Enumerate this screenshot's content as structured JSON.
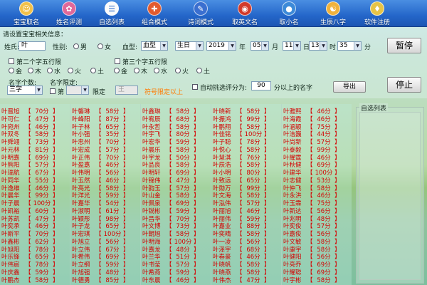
{
  "toolbar": {
    "items": [
      {
        "label": "宝宝取名",
        "icon": "baby-icon",
        "color": "#f2c14a",
        "glyph": "☺"
      },
      {
        "label": "姓名评测",
        "icon": "flower-icon",
        "color": "#e0689a",
        "glyph": "✿"
      },
      {
        "label": "自选列表",
        "icon": "list-icon",
        "color": "#fbfbfb",
        "glyph": "☰"
      },
      {
        "label": "组合模式",
        "icon": "puzzle-icon",
        "color": "#e25b2f",
        "glyph": "✚"
      },
      {
        "label": "诗词模式",
        "icon": "book-icon",
        "color": "#3a6fd0",
        "glyph": "✎"
      },
      {
        "label": "取英文名",
        "icon": "globe-icon",
        "color": "#d23a2a",
        "glyph": "◉"
      },
      {
        "label": "取小名",
        "icon": "sphere-icon",
        "color": "#3d8ad8",
        "glyph": "●"
      },
      {
        "label": "生辰八字",
        "icon": "bagua-icon",
        "color": "#f0b23c",
        "glyph": "☯"
      },
      {
        "label": "软件注册",
        "icon": "lock-icon",
        "color": "#e7c447",
        "glyph": "♦"
      }
    ]
  },
  "settings": {
    "group_title": "请设置宝宝相关信息：",
    "surname_label": "姓氏:",
    "surname_value": "叶",
    "gender_label": "性别:",
    "gender_male": "男",
    "gender_female": "女",
    "blood_label": "血型:",
    "blood_value": "血型",
    "birthday_type": "生日",
    "year_value": "2019",
    "year_unit": "年",
    "month_value": "05",
    "month_unit": "月",
    "day_value": "11",
    "day_unit": "日",
    "hour_value": "13",
    "hour_unit": "时",
    "minute_value": "35",
    "minute_unit": "分",
    "pause_button": "暂停",
    "second_char_limit": "第二个字五行限",
    "third_char_limit": "第三个字五行限",
    "elements": [
      "金",
      "木",
      "水",
      "火",
      "土"
    ],
    "name_count_label": "名字个数:",
    "name_count_value": "三字",
    "name_limit_label": "名字限定:",
    "name_limit_pos": "第",
    "limit_char_label": "限定",
    "limit_char_value": "王",
    "hint_text": "符号限定以上",
    "auto_pick_label": "自动挑选评分为:",
    "auto_pick_score": "90",
    "score_suffix": "分以上的名字",
    "export_button": "导出",
    "stop_button": "停止",
    "self_list_title": "自选列表",
    "colors": {
      "accent_red": "#d50000",
      "hint_orange": "#ff7a00",
      "toolbar_blue": "#2466c9"
    }
  },
  "results": {
    "columns": [
      [
        {
          "name": "叶晋旭",
          "score": "70分"
        },
        {
          "name": "叶可仁",
          "score": "47分"
        },
        {
          "name": "叶宛州",
          "score": "46分"
        },
        {
          "name": "叶双冬",
          "score": "58分"
        },
        {
          "name": "叶舜翊",
          "score": "73分"
        },
        {
          "name": "叶元林",
          "score": "81分"
        },
        {
          "name": "叶明嘉",
          "score": "69分"
        },
        {
          "name": "叶熊阳",
          "score": "57分"
        },
        {
          "name": "叶瑞航",
          "score": "67分"
        },
        {
          "name": "叶同华",
          "score": "55分"
        },
        {
          "name": "叶逸维",
          "score": "46分"
        },
        {
          "name": "叶晨华",
          "score": "99分"
        },
        {
          "name": "叶子晨",
          "score": "100分"
        },
        {
          "name": "叶凯裕",
          "score": "60分"
        },
        {
          "name": "叶苏凯",
          "score": "47分"
        },
        {
          "name": "叶奕承",
          "score": "46分"
        },
        {
          "name": "叶斯平",
          "score": "70分"
        },
        {
          "name": "叶鑫彬",
          "score": "62分"
        },
        {
          "name": "叶旭阳",
          "score": "78分"
        },
        {
          "name": "叶乐锋",
          "score": "65分"
        },
        {
          "name": "叶伟宸",
          "score": "78分"
        },
        {
          "name": "叶庆鑫",
          "score": "59分"
        },
        {
          "name": "叶鹏杰",
          "score": "58分"
        }
      ],
      [
        {
          "name": "叶馨琳",
          "score": "58分"
        },
        {
          "name": "叶峰阳",
          "score": "87分"
        },
        {
          "name": "叶子林",
          "score": "65分"
        },
        {
          "name": "叶小强",
          "score": "35分"
        },
        {
          "name": "叶忠州",
          "score": "70分"
        },
        {
          "name": "叶宏成",
          "score": "57分"
        },
        {
          "name": "叶正伟",
          "score": "70分"
        },
        {
          "name": "叶盈嘉",
          "score": "46分"
        },
        {
          "name": "叶伟明",
          "score": "56分"
        },
        {
          "name": "叶玉然",
          "score": "46分"
        },
        {
          "name": "叶亮光",
          "score": "58分"
        },
        {
          "name": "叶洋光",
          "score": "59分"
        },
        {
          "name": "叶嘉华",
          "score": "54分"
        },
        {
          "name": "叶淑明",
          "score": "61分"
        },
        {
          "name": "叶颖彤",
          "score": "98分"
        },
        {
          "name": "叶子龙",
          "score": "65分"
        },
        {
          "name": "叶宏琪",
          "score": "100分"
        },
        {
          "name": "叶旭立",
          "score": "56分"
        },
        {
          "name": "叶立伟",
          "score": "67分"
        },
        {
          "name": "叶希伟",
          "score": "69分"
        },
        {
          "name": "叶立纲",
          "score": "59分"
        },
        {
          "name": "叶旭强",
          "score": "48分"
        },
        {
          "name": "叶德勇",
          "score": "85分"
        }
      ],
      [
        {
          "name": "叶鑫琳",
          "score": "58分"
        },
        {
          "name": "叶宥辰",
          "score": "68分"
        },
        {
          "name": "叶永哲",
          "score": "58分"
        },
        {
          "name": "叶宇飞",
          "score": "80分"
        },
        {
          "name": "叶宏华",
          "score": "59分"
        },
        {
          "name": "叶晨乐",
          "score": "58分"
        },
        {
          "name": "叶宇龙",
          "score": "50分"
        },
        {
          "name": "叶品良",
          "score": "58分"
        },
        {
          "name": "叶明轩",
          "score": "69分"
        },
        {
          "name": "叶锦伟",
          "score": "47分"
        },
        {
          "name": "叶韵玉",
          "score": "57分"
        },
        {
          "name": "叶山金",
          "score": "58分"
        },
        {
          "name": "叶佩泉",
          "score": "69分"
        },
        {
          "name": "叶锐彬",
          "score": "59分"
        },
        {
          "name": "叶昌华",
          "score": "70分"
        },
        {
          "name": "叶文博",
          "score": "73分"
        },
        {
          "name": "叶朝旭",
          "score": "58分"
        },
        {
          "name": "叶明海",
          "score": "100分"
        },
        {
          "name": "叶嘉龙",
          "score": "48分"
        },
        {
          "name": "叶兰华",
          "score": "51分"
        },
        {
          "name": "叶书莹",
          "score": "57分"
        },
        {
          "name": "叶希燕",
          "score": "59分"
        },
        {
          "name": "叶东晨",
          "score": "46分"
        }
      ],
      [
        {
          "name": "叶晓新",
          "score": "58分"
        },
        {
          "name": "叶振鸿",
          "score": "99分"
        },
        {
          "name": "叶鹏翔",
          "score": "58分"
        },
        {
          "name": "叶佳铭",
          "score": "100分"
        },
        {
          "name": "叶子聪",
          "score": "78分"
        },
        {
          "name": "叶悦心",
          "score": "58分"
        },
        {
          "name": "叶慧淇",
          "score": "76分"
        },
        {
          "name": "叶辰浩",
          "score": "58分"
        },
        {
          "name": "叶小明",
          "score": "80分"
        },
        {
          "name": "叶致远",
          "score": "65分"
        },
        {
          "name": "叶勋万",
          "score": "99分"
        },
        {
          "name": "叶文海",
          "score": "58分"
        },
        {
          "name": "叶泓伟",
          "score": "57分"
        },
        {
          "name": "叶丽旭",
          "score": "46分"
        },
        {
          "name": "叶丽伟",
          "score": "59分"
        },
        {
          "name": "叶嘉业",
          "score": "88分"
        },
        {
          "name": "叶奕晴",
          "score": "58分"
        },
        {
          "name": "叶一凌",
          "score": "56分"
        },
        {
          "name": "叶泽宇",
          "score": "68分"
        },
        {
          "name": "叶春豪",
          "score": "46分"
        },
        {
          "name": "叶晓帆",
          "score": "58分"
        },
        {
          "name": "叶晓燕",
          "score": "58分"
        },
        {
          "name": "叶伟杰",
          "score": "47分"
        }
      ],
      [
        {
          "name": "叶雅熙",
          "score": "46分"
        },
        {
          "name": "叶海霞",
          "score": "46分"
        },
        {
          "name": "叶涵颖",
          "score": "75分"
        },
        {
          "name": "叶洁巍",
          "score": "44分"
        },
        {
          "name": "叶尚新",
          "score": "57分"
        },
        {
          "name": "叶泰毅",
          "score": "99分"
        },
        {
          "name": "叶耀霆",
          "score": "46分"
        },
        {
          "name": "叶秋健",
          "score": "69分"
        },
        {
          "name": "叶建华",
          "score": "100分"
        },
        {
          "name": "叶志健",
          "score": "53分"
        },
        {
          "name": "叶仲飞",
          "score": "58分"
        },
        {
          "name": "叶永洪",
          "score": "46分"
        },
        {
          "name": "叶玉霖",
          "score": "75分"
        },
        {
          "name": "叶新达",
          "score": "56分"
        },
        {
          "name": "叶兆明",
          "score": "48分"
        },
        {
          "name": "叶奕俊",
          "score": "57分"
        },
        {
          "name": "叶嘉俊",
          "score": "56分"
        },
        {
          "name": "叶文敏",
          "score": "58分"
        },
        {
          "name": "叶康宇",
          "score": "58分"
        },
        {
          "name": "叶健阳",
          "score": "56分"
        },
        {
          "name": "叶亮乔",
          "score": "69分"
        },
        {
          "name": "叶耀聪",
          "score": "69分"
        },
        {
          "name": "叶宇彬",
          "score": "58分"
        }
      ]
    ]
  }
}
